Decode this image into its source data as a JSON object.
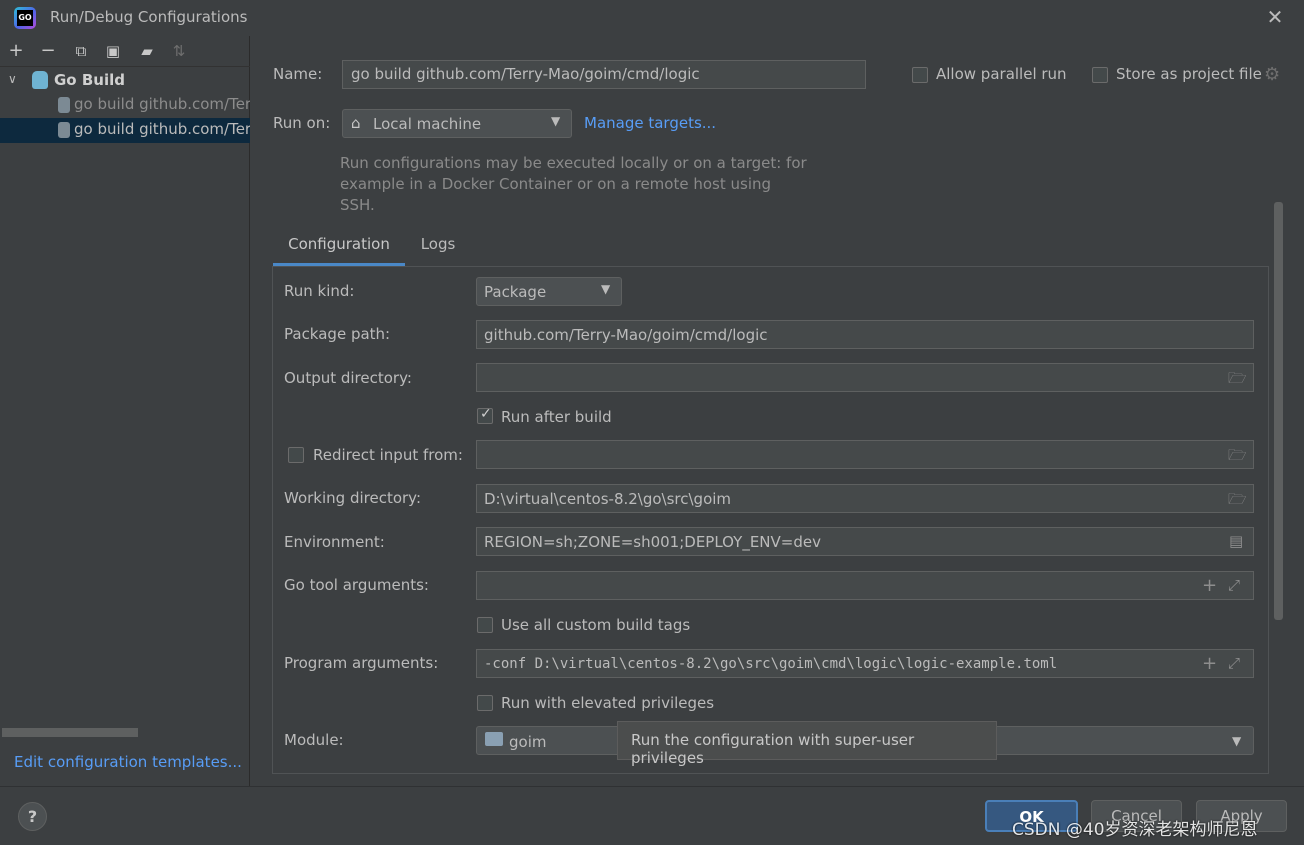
{
  "window": {
    "title": "Run/Debug Configurations",
    "logo_text": "GO"
  },
  "sidebar": {
    "group_label": "Go Build",
    "items": [
      {
        "label": "go build github.com/Terry-Mao/goim/cmd/comet"
      },
      {
        "label": "go build github.com/Terry-Mao/goim/cmd/logic"
      }
    ],
    "edit_templates_link": "Edit configuration templates..."
  },
  "header": {
    "name_label": "Name:",
    "name_value": "go build github.com/Terry-Mao/goim/cmd/logic",
    "allow_parallel_label": "Allow parallel run",
    "allow_parallel_checked": false,
    "store_project_label": "Store as project file",
    "store_project_checked": false,
    "run_on_label": "Run on:",
    "run_on_value": "Local machine",
    "manage_targets_link": "Manage targets...",
    "run_on_hint": "Run configurations may be executed locally or on a target: for example in a Docker Container or on a remote host using SSH."
  },
  "tabs": [
    {
      "label": "Configuration",
      "active": true
    },
    {
      "label": "Logs",
      "active": false
    }
  ],
  "config": {
    "run_kind_label": "Run kind:",
    "run_kind_value": "Package",
    "package_path_label": "Package path:",
    "package_path_value": "github.com/Terry-Mao/goim/cmd/logic",
    "output_dir_label": "Output directory:",
    "output_dir_value": "",
    "run_after_build_label": "Run after build",
    "run_after_build_checked": true,
    "redirect_input_label": "Redirect input from:",
    "redirect_input_checked": false,
    "redirect_input_value": "",
    "working_dir_label": "Working directory:",
    "working_dir_value": "D:\\virtual\\centos-8.2\\go\\src\\goim",
    "environment_label": "Environment:",
    "environment_value": "REGION=sh;ZONE=sh001;DEPLOY_ENV=dev",
    "go_tool_args_label": "Go tool arguments:",
    "go_tool_args_value": "",
    "custom_tags_label": "Use all custom build tags",
    "custom_tags_checked": false,
    "program_args_label": "Program arguments:",
    "program_args_value": "-conf D:\\virtual\\centos-8.2\\go\\src\\goim\\cmd\\logic\\logic-example.toml",
    "elevated_label": "Run with elevated privileges",
    "elevated_checked": false,
    "module_label": "Module:",
    "module_value": "goim"
  },
  "tooltip": {
    "text": "Run the configuration with super-user privileges"
  },
  "footer": {
    "help_label": "?",
    "ok_label": "OK",
    "cancel_label": "Cancel",
    "apply_label": "Apply",
    "watermark": "CSDN @40岁资深老架构师尼恩"
  },
  "colors": {
    "background": "#3c3f41",
    "link": "#589df6",
    "selection": "#0d293e",
    "accent": "#4a88c7"
  }
}
